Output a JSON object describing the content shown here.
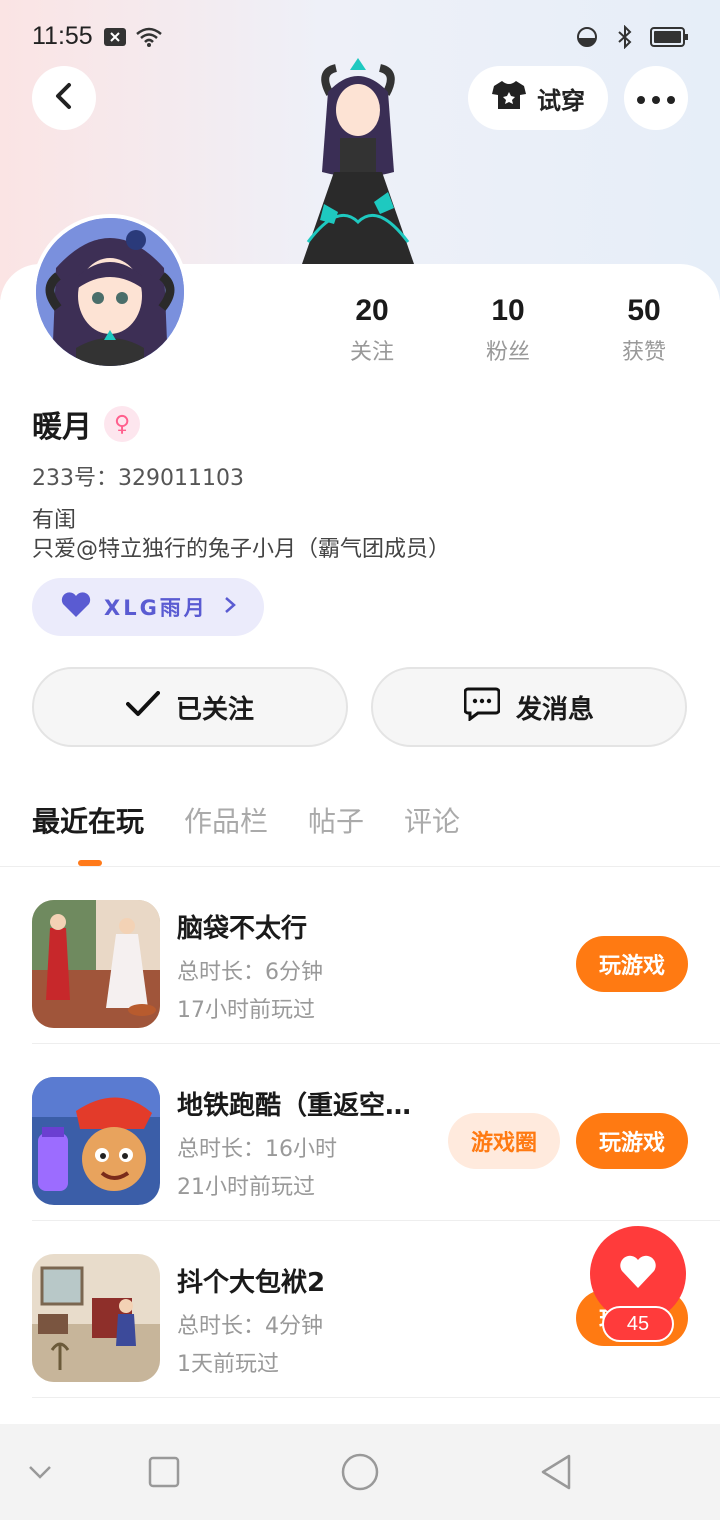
{
  "status_bar": {
    "time": "11:55",
    "icons_left": [
      "notification-x-icon",
      "wifi-icon"
    ],
    "icons_right": [
      "dnd-icon",
      "bluetooth-icon",
      "battery-icon"
    ]
  },
  "header": {
    "try_on_label": "试穿"
  },
  "profile": {
    "name": "暖月",
    "gender_symbol": "♀",
    "uid": "233号：329011103",
    "bio_line1": "有闺",
    "bio_line2": "只爱@特立独行的兔子小月（霸气团成员）",
    "guild_label": "XLG雨月"
  },
  "stats": [
    {
      "value": "20",
      "label": "关注"
    },
    {
      "value": "10",
      "label": "粉丝"
    },
    {
      "value": "50",
      "label": "获赞"
    }
  ],
  "actions": {
    "followed_label": "已关注",
    "message_label": "发消息"
  },
  "tabs": [
    "最近在玩",
    "作品栏",
    "帖子",
    "评论"
  ],
  "games": [
    {
      "title": "脑袋不太行",
      "duration": "总时长：6分钟",
      "last_played": "17小时前玩过",
      "play_label": "玩游戏"
    },
    {
      "title": "地铁跑酷（重返空…",
      "duration": "总时长：16小时",
      "last_played": "21小时前玩过",
      "circle_label": "游戏圈",
      "play_label": "玩游戏"
    },
    {
      "title": "抖个大包袱2",
      "duration": "总时长：4分钟",
      "last_played": "1天前玩过",
      "play_label": "玩游戏"
    }
  ],
  "like": {
    "count": "45"
  },
  "colors": {
    "accent_orange": "#ff7a12",
    "guild_purple": "#5a5bd2",
    "like_red": "#ff3b3b"
  }
}
